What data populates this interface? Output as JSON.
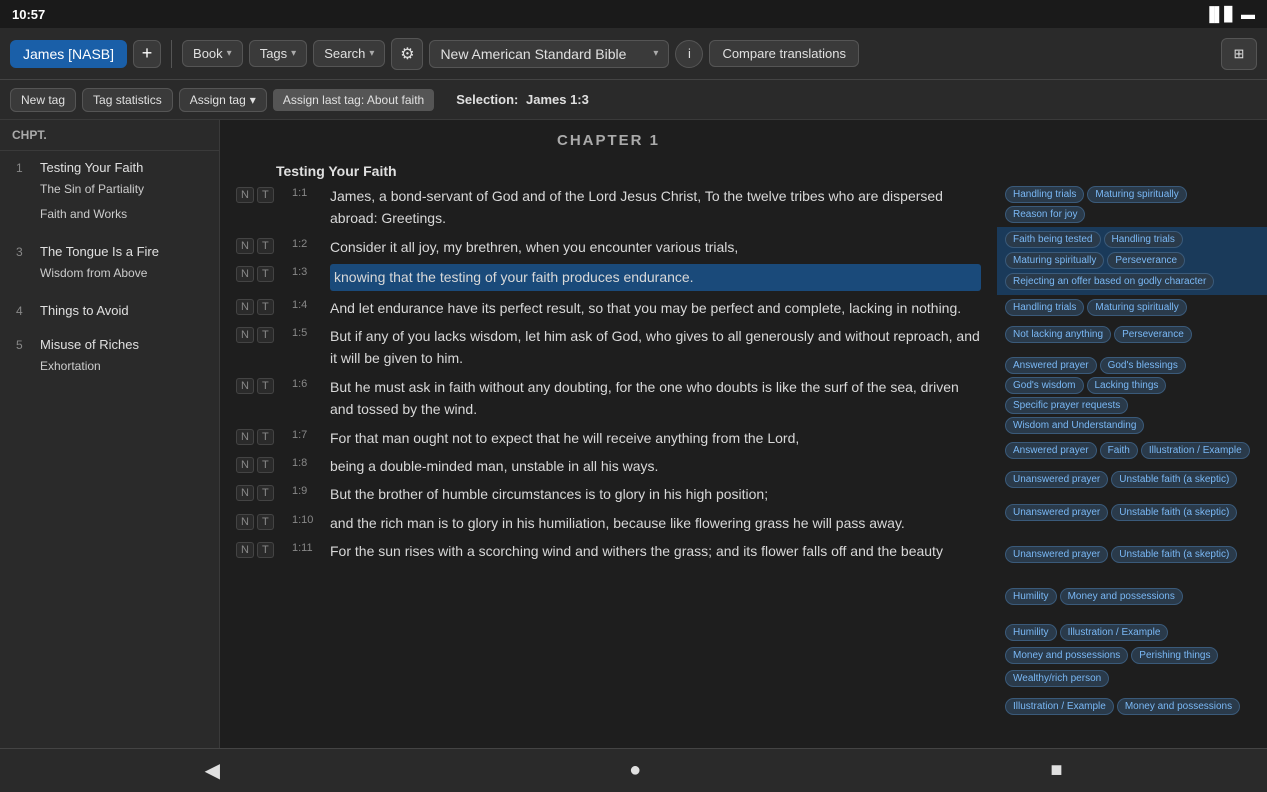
{
  "status": {
    "time": "10:57",
    "wifi_icon": "📶",
    "battery_icon": "🔋"
  },
  "toolbar": {
    "tab_label": "James [NASB]",
    "plus_label": "+",
    "book_label": "Book",
    "tags_label": "Tags",
    "search_label": "Search",
    "gear_icon": "⚙",
    "bible_label": "New American Standard Bible",
    "info_label": "i",
    "compare_label": "Compare translations",
    "layout_icon": "⊞"
  },
  "toolbar2": {
    "new_tag_label": "New tag",
    "tag_stats_label": "Tag statistics",
    "assign_tag_label": "Assign tag",
    "assign_last_label": "Assign last tag: About faith",
    "selection_prefix": "Selection:",
    "selection_value": "James 1:3"
  },
  "sidebar": {
    "header_label": "Chpt.",
    "chapters": [
      {
        "num": "1",
        "sections": [
          {
            "label": "Testing Your Faith"
          },
          {
            "label": "The Sin of Partiality"
          },
          {
            "label": "Faith and Works"
          }
        ]
      },
      {
        "num": "3",
        "sections": [
          {
            "label": "The Tongue Is a Fire"
          },
          {
            "label": "Wisdom from Above"
          }
        ]
      },
      {
        "num": "4",
        "sections": [
          {
            "label": "Things to Avoid"
          }
        ]
      },
      {
        "num": "5",
        "sections": [
          {
            "label": "Misuse of Riches"
          },
          {
            "label": "Exhortation"
          }
        ]
      }
    ]
  },
  "content": {
    "chapter_label": "CHAPTER 1",
    "section_heading": "Testing Your Faith",
    "verses": [
      {
        "ref": "1:1",
        "text": "James, a bond-servant of God and of the Lord Jesus Christ, To the twelve tribes who are dispersed abroad: Greetings.",
        "tags": []
      },
      {
        "ref": "1:2",
        "text": "Consider it all joy, my brethren, when you encounter various trials,",
        "tags": [
          {
            "label": "Handling trials",
            "color": "blue"
          },
          {
            "label": "Maturing spiritually",
            "color": "blue"
          },
          {
            "label": "Reason for joy",
            "color": "blue"
          }
        ]
      },
      {
        "ref": "1:3",
        "text": "knowing that the testing of your faith produces endurance.",
        "highlighted": true,
        "tags": [
          {
            "label": "Faith being tested",
            "color": "blue"
          },
          {
            "label": "Handling trials",
            "color": "blue"
          },
          {
            "label": "Maturing spiritually",
            "color": "blue"
          },
          {
            "label": "Perseverance",
            "color": "blue"
          },
          {
            "label": "Rejecting an offer based on godly character",
            "color": "blue"
          }
        ]
      },
      {
        "ref": "1:4",
        "text": "And let endurance have its perfect result, so that you may be perfect and complete, lacking in nothing.",
        "tags": [
          {
            "label": "Handling trials",
            "color": "blue"
          },
          {
            "label": "Maturing spiritually",
            "color": "blue"
          },
          {
            "label": "Not lacking anything",
            "color": "blue"
          },
          {
            "label": "Perseverance",
            "color": "blue"
          }
        ]
      },
      {
        "ref": "1:5",
        "text": "But if any of you lacks wisdom, let him ask of God, who gives to all generously and without reproach, and it will be given to him.",
        "tags": [
          {
            "label": "Answered prayer",
            "color": "blue"
          },
          {
            "label": "God's blessings",
            "color": "blue"
          },
          {
            "label": "God's wisdom",
            "color": "blue"
          },
          {
            "label": "Lacking things",
            "color": "blue"
          },
          {
            "label": "Specific prayer requests",
            "color": "blue"
          },
          {
            "label": "Wisdom and Understanding",
            "color": "blue"
          }
        ]
      },
      {
        "ref": "1:6",
        "text": "But he must ask in faith without any doubting, for the one who doubts is like the surf of the sea, driven and tossed by the wind.",
        "tags": [
          {
            "label": "Answered prayer",
            "color": "blue"
          },
          {
            "label": "Faith",
            "color": "blue"
          },
          {
            "label": "Illustration / Example",
            "color": "blue"
          },
          {
            "label": "Unanswered prayer",
            "color": "blue"
          },
          {
            "label": "Unstable faith (a skeptic)",
            "color": "blue"
          }
        ]
      },
      {
        "ref": "1:7",
        "text": "For that man ought not to expect that he will receive anything from the Lord,",
        "tags": [
          {
            "label": "Unanswered prayer",
            "color": "blue"
          },
          {
            "label": "Unstable faith (a skeptic)",
            "color": "blue"
          }
        ]
      },
      {
        "ref": "1:8",
        "text": "being a double-minded man, unstable in all his ways.",
        "tags": [
          {
            "label": "Unanswered prayer",
            "color": "blue"
          },
          {
            "label": "Unstable faith (a skeptic)",
            "color": "blue"
          }
        ]
      },
      {
        "ref": "1:9",
        "text": "But the brother of humble circumstances is to glory in his high position;",
        "tags": [
          {
            "label": "Humility",
            "color": "blue"
          },
          {
            "label": "Money and possessions",
            "color": "blue"
          }
        ]
      },
      {
        "ref": "1:10",
        "text": "and the rich man is to glory in his humiliation, because like flowering grass he will pass away.",
        "tags": [
          {
            "label": "Humility",
            "color": "blue"
          },
          {
            "label": "Illustration / Example",
            "color": "blue"
          },
          {
            "label": "Money and possessions",
            "color": "blue"
          },
          {
            "label": "Perishing things",
            "color": "blue"
          },
          {
            "label": "Wealthy/rich person",
            "color": "blue"
          }
        ]
      },
      {
        "ref": "1:11",
        "text": "For the sun rises with a scorching wind and withers the grass; and its flower falls off and the beauty",
        "tags": [
          {
            "label": "Illustration / Example",
            "color": "blue"
          },
          {
            "label": "Money and possessions",
            "color": "blue"
          }
        ]
      }
    ]
  },
  "bottom_nav": {
    "back_icon": "◀",
    "home_icon": "●",
    "square_icon": "■"
  }
}
